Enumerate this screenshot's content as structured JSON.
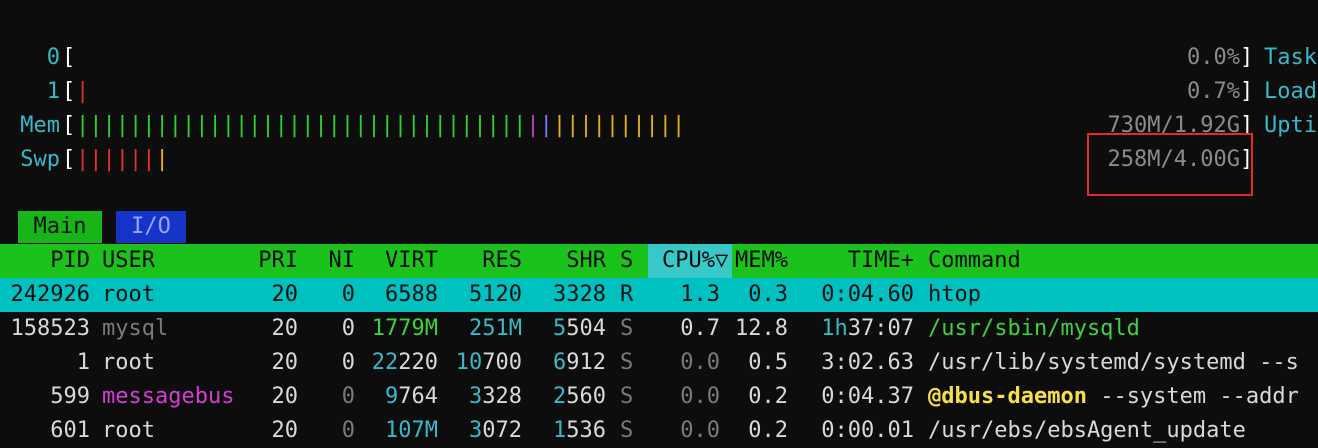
{
  "meters": {
    "cpu0": {
      "label": "0",
      "value": "0.0%",
      "right_label": "Task"
    },
    "cpu1": {
      "label": "1",
      "value": "0.7%",
      "right_label": "Load"
    },
    "mem": {
      "label": "Mem",
      "value": "730M/1.92G",
      "right_label": "Upti"
    },
    "swp": {
      "label": "Swp",
      "value": "258M/4.00G"
    }
  },
  "tabs": {
    "main": "Main",
    "io": "I/O"
  },
  "columns": {
    "pid": "PID",
    "user": "USER",
    "pri": "PRI",
    "ni": "NI",
    "virt": "VIRT",
    "res": "RES",
    "shr": "SHR",
    "s": "S",
    "cpu": "CPU%▽",
    "mem": "MEM%",
    "time": "TIME+",
    "command": "Command"
  },
  "processes": [
    {
      "pid": "242926",
      "user": "root",
      "pri": "20",
      "ni": "0",
      "virt": "6588",
      "res": "5120",
      "shr": "3328",
      "s": "R",
      "cpu": "1.3",
      "mem": "0.3",
      "time": "0:04.60",
      "command": "htop"
    },
    {
      "pid": "158523",
      "user": "mysql",
      "pri": "20",
      "ni": "0",
      "virt": "1779M",
      "res": "251M",
      "shr_a": "5",
      "shr_b": "504",
      "s": "S",
      "cpu": "0.7",
      "mem": "12.8",
      "time_a": "1h",
      "time_b": "37:07",
      "command": "/usr/sbin/mysqld"
    },
    {
      "pid": "1",
      "user": "root",
      "pri": "20",
      "ni": "0",
      "virt_a": "22",
      "virt_b": "220",
      "res_a": "10",
      "res_b": "700",
      "shr_a": "6",
      "shr_b": "912",
      "s": "S",
      "cpu": "0.0",
      "mem": "0.5",
      "time": "3:02.63",
      "command": "/usr/lib/systemd/systemd --s"
    },
    {
      "pid": "599",
      "user": "messagebus",
      "pri": "20",
      "ni": "0",
      "virt_a": "9",
      "virt_b": "764",
      "res_a": "3",
      "res_b": "328",
      "shr_a": "2",
      "shr_b": "560",
      "s": "S",
      "cpu": "0.0",
      "mem": "0.2",
      "time": "0:04.37",
      "command_a": "@dbus-daemon",
      "command_b": " --system --addr"
    },
    {
      "pid": "601",
      "user": "root",
      "pri": "20",
      "ni": "0",
      "virt": "107M",
      "res_a": "3",
      "res_b": "072",
      "shr_a": "1",
      "shr_b": "536",
      "s": "S",
      "cpu": "0.0",
      "mem": "0.2",
      "time": "0:00.01",
      "command": "/usr/ebs/ebsAgent_update"
    }
  ],
  "colors": {
    "header_bg": "#1bc21b",
    "selected_row": "#00c0c0",
    "highlight_box": "#e12b25"
  }
}
